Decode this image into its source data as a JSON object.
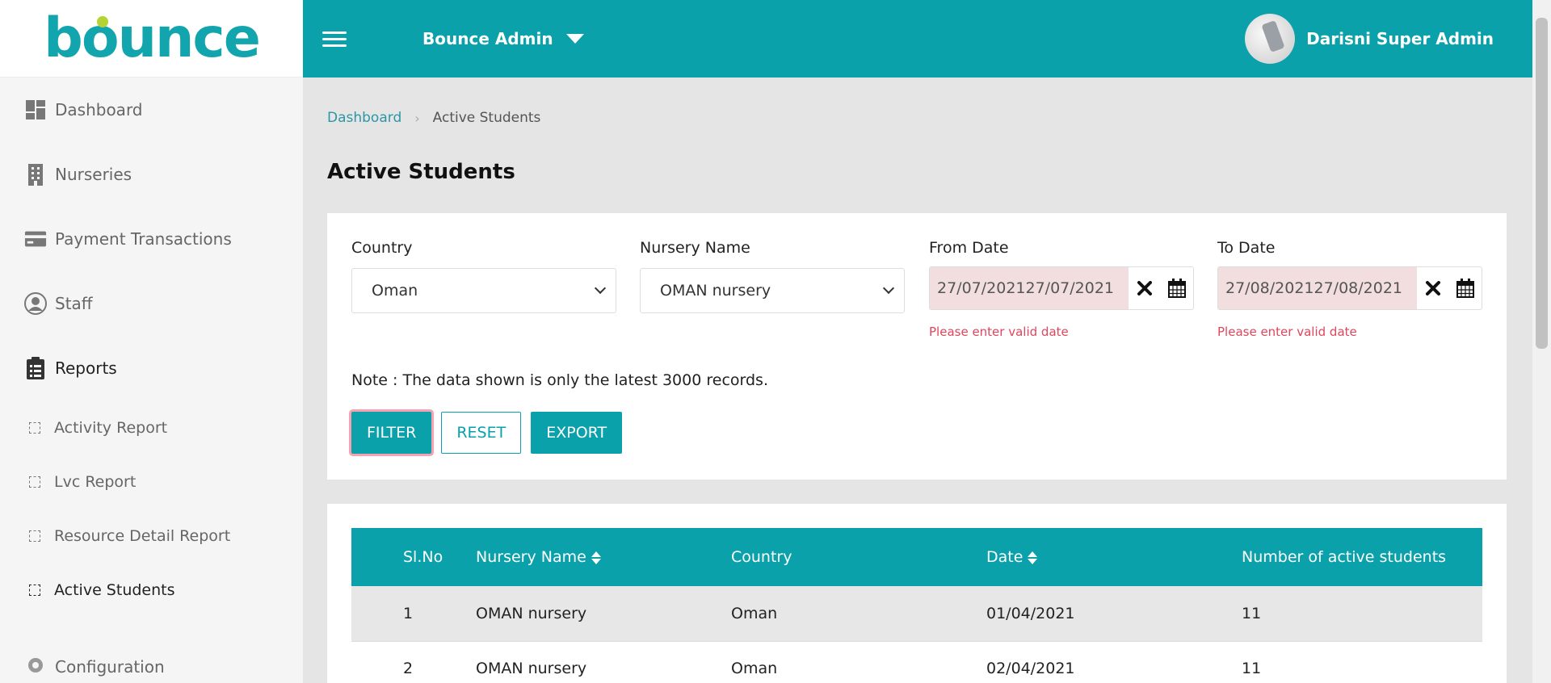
{
  "brand": {
    "logo_text": "bounce",
    "colors": {
      "primary": "#0aa1ab",
      "accent_dot": "#b5d334",
      "error": "#e0455c"
    }
  },
  "header": {
    "title": "Bounce Admin",
    "user_name": "Darisni Super Admin"
  },
  "sidebar": {
    "items": [
      {
        "label": "Dashboard",
        "icon": "dashboard-icon"
      },
      {
        "label": "Nurseries",
        "icon": "building-icon"
      },
      {
        "label": "Payment Transactions",
        "icon": "credit-card-icon"
      },
      {
        "label": "Staff",
        "icon": "user-circle-icon"
      },
      {
        "label": "Reports",
        "icon": "clipboard-icon"
      }
    ],
    "sub_items": [
      {
        "label": "Activity Report"
      },
      {
        "label": "Lvc Report"
      },
      {
        "label": "Resource Detail Report"
      },
      {
        "label": "Active Students"
      }
    ],
    "partial_item": {
      "label": "Configuration",
      "icon": "gear-icon"
    }
  },
  "breadcrumb": {
    "home": "Dashboard",
    "current": "Active Students"
  },
  "page": {
    "title": "Active Students"
  },
  "filters": {
    "country": {
      "label": "Country",
      "value": "Oman"
    },
    "nursery": {
      "label": "Nursery Name",
      "value": "OMAN nursery"
    },
    "from_date": {
      "label": "From Date",
      "value": "27/07/202127/07/2021",
      "error": "Please enter valid date"
    },
    "to_date": {
      "label": "To Date",
      "value": "27/08/202127/08/2021",
      "error": "Please enter valid date"
    }
  },
  "note": "Note : The data shown is only the latest 3000 records.",
  "buttons": {
    "filter": "FILTER",
    "reset": "RESET",
    "export": "EXPORT"
  },
  "table": {
    "headers": [
      "Sl.No",
      "Nursery Name",
      "Country",
      "Date",
      "Number of active students"
    ],
    "rows": [
      [
        "1",
        "OMAN nursery",
        "Oman",
        "01/04/2021",
        "11"
      ],
      [
        "2",
        "OMAN nursery",
        "Oman",
        "02/04/2021",
        "11"
      ]
    ]
  }
}
